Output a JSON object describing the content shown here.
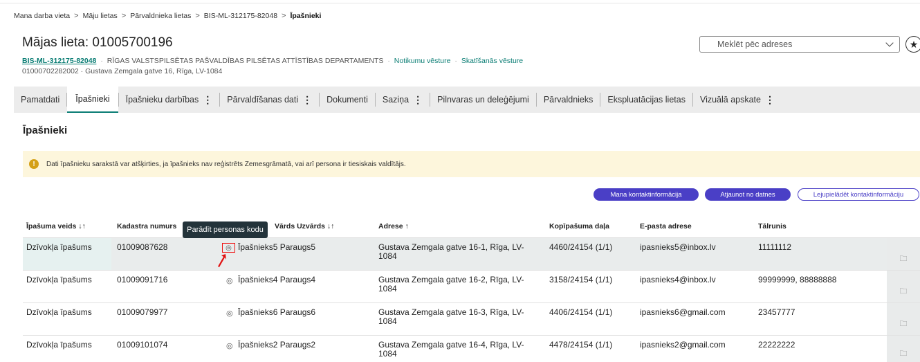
{
  "breadcrumb": [
    "Mana darba vieta",
    "Māju lietas",
    "Pārvaldnieka lietas",
    "BIS-ML-312175-82048",
    "Īpašnieki"
  ],
  "header": {
    "title": "Mājas lieta: 01005700196",
    "code": "BIS-ML-312175-82048",
    "department": "RĪGAS VALSTSPILSĒTAS PAŠVALDĪBAS PILSĒTAS ATTĪSTĪBAS DEPARTAMENTS",
    "link_history": "Notikumu vēsture",
    "link_views": "Skatīšanās vēsture",
    "address_line": "01000702282002 · Gustava Zemgala gatve 16, Rīga, LV-1084"
  },
  "search": {
    "placeholder": "Meklēt pēc adreses"
  },
  "tabs": [
    {
      "label": "Pamatdati",
      "menu": false
    },
    {
      "label": "Īpašnieki",
      "menu": false,
      "active": true
    },
    {
      "label": "Īpašnieku darbības",
      "menu": true
    },
    {
      "label": "Pārvaldīšanas dati",
      "menu": true
    },
    {
      "label": "Dokumenti",
      "menu": false
    },
    {
      "label": "Saziņa",
      "menu": true
    },
    {
      "label": "Pilnvaras un deleģējumi",
      "menu": false
    },
    {
      "label": "Pārvaldnieks",
      "menu": false
    },
    {
      "label": "Ekspluatācijas lietas",
      "menu": false
    },
    {
      "label": "Vizuālā apskate",
      "menu": true
    }
  ],
  "section_title": "Īpašnieki",
  "notice": "Dati īpašnieku sarakstā var atšķirties, ja īpašnieks nav reģistrēts Zemesgrāmatā, vai arī persona ir tiesiskais valdītājs.",
  "buttons": {
    "my_contacts": "Mana kontaktinformācija",
    "refresh": "Atjaunot no datnes",
    "download": "Lejupielādēt kontaktinformāciju"
  },
  "tooltip": "Parādīt personas kodu",
  "table": {
    "headers": {
      "type": "Īpašuma veids ↓↑",
      "cadastre": "Kadastra numurs",
      "name": "Vārds Uzvārds ↓↑",
      "address": "Adrese ↑",
      "share": "Kopīpašuma daļa",
      "email": "E-pasta adrese",
      "phone": "Tālrunis"
    },
    "rows": [
      {
        "type": "Dzīvokļa īpašums",
        "cadastre": "01009087628",
        "name": "Īpašnieks5 Paraugs5",
        "address1": "Gustava Zemgala gatve 16-1, Rīga, LV-",
        "address2": "1084",
        "share": "4460/24154 (1/1)",
        "email": "ipasnieks5@inbox.lv",
        "phone": "11111112"
      },
      {
        "type": "Dzīvokļa īpašums",
        "cadastre": "01009091716",
        "name": "Īpašnieks4 Paraugs4",
        "address1": "Gustava Zemgala gatve 16-2, Rīga, LV-",
        "address2": "1084",
        "share": "3158/24154 (1/1)",
        "email": "ipasnieks4@inbox.lv",
        "phone": "99999999, 88888888"
      },
      {
        "type": "Dzīvokļa īpašums",
        "cadastre": "01009079977",
        "name": "Īpašnieks6 Paraugs6",
        "address1": "Gustava Zemgala gatve 16-3, Rīga, LV-",
        "address2": "1084",
        "share": "4406/24154 (1/1)",
        "email": "ipasnieks6@gmail.com",
        "phone": "23457777"
      },
      {
        "type": "Dzīvokļa īpašums",
        "cadastre": "01009101074",
        "name": "Īpašnieks2 Paraugs2",
        "address1": "Gustava Zemgala gatve 16-4, Rīga, LV-",
        "address2": "1084",
        "share": "4478/24154 (1/1)",
        "email": "ipasnieks2@gmail.com",
        "phone": "22222222"
      }
    ]
  },
  "icons": {
    "eye": "eye-icon",
    "folder": "folder-icon",
    "star": "star-icon",
    "warning": "info-icon",
    "chevron": "chevron-down-icon"
  },
  "colors": {
    "accent": "#0a7d74",
    "primary_button": "#4a3fc6",
    "notice_bg": "#fdf6dc",
    "highlight": "#e11111"
  }
}
